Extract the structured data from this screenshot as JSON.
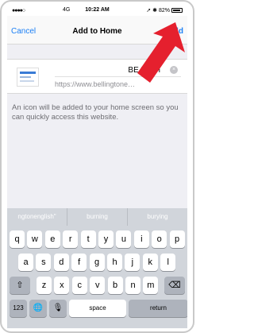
{
  "status_bar": {
    "signal": "●●●●○",
    "network": "4G",
    "time": "10:22 AM",
    "right": "➚ ✱ 82%"
  },
  "navbar": {
    "cancel_label": "Cancel",
    "title": "Add to Home",
    "add_label": "Add"
  },
  "bookmark": {
    "name": "BE Login",
    "url": "https://www.bellingtone…",
    "clear_symbol": "×"
  },
  "hint": "An icon will be added to your home screen so you can quickly access this website.",
  "suggestions": [
    "ngtonenglish\"",
    "burning",
    "burying"
  ],
  "keyboard": {
    "row1": [
      "q",
      "w",
      "e",
      "r",
      "t",
      "y",
      "u",
      "i",
      "o",
      "p"
    ],
    "row2": [
      "a",
      "s",
      "d",
      "f",
      "g",
      "h",
      "j",
      "k",
      "l"
    ],
    "row3": [
      "z",
      "x",
      "c",
      "v",
      "b",
      "n",
      "m"
    ],
    "shift_symbol": "⇧",
    "backspace_symbol": "⌫",
    "numbers_label": "123",
    "globe_symbol": "🌐",
    "mic_symbol": "🎙",
    "space_label": "space",
    "return_label": "return"
  },
  "colors": {
    "accent": "#1a7ff5",
    "arrow": "#e5202e"
  }
}
